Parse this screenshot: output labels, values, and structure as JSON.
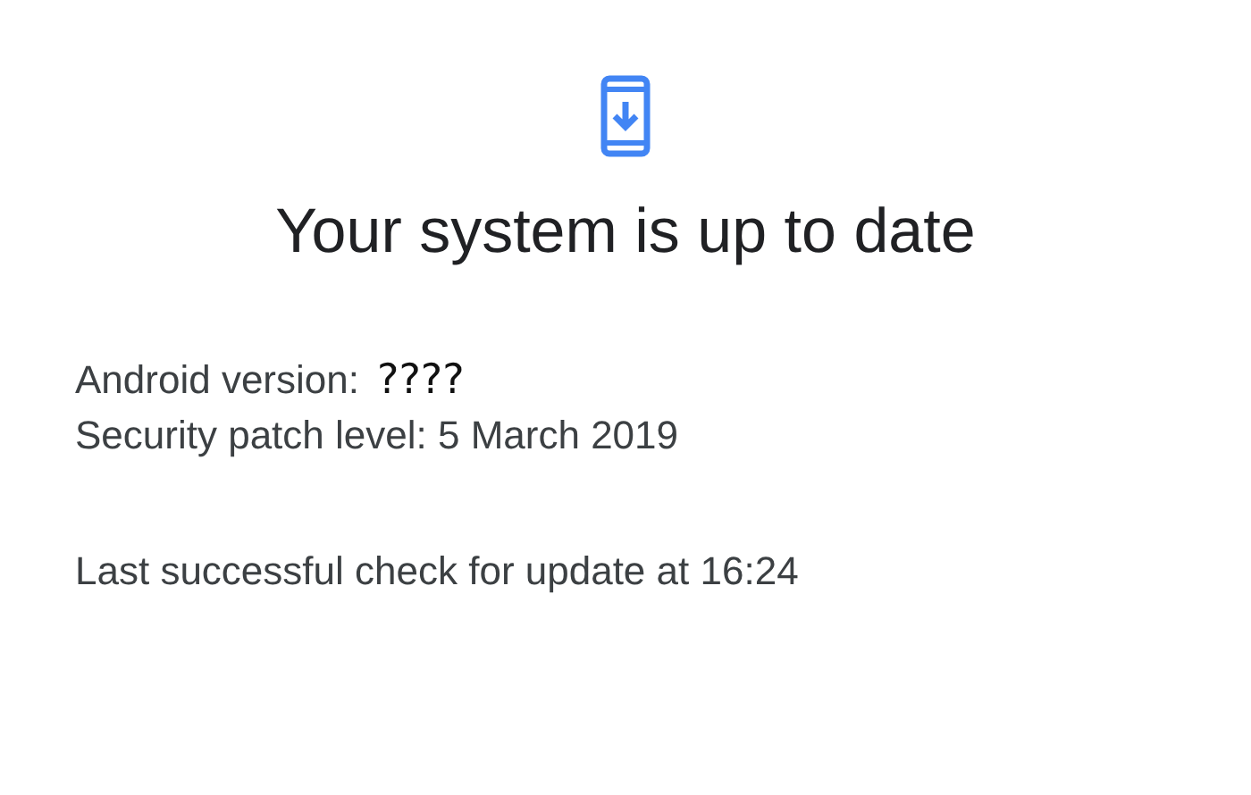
{
  "title": "Your system is up to date",
  "details": [
    {
      "kind": "pair",
      "label": "Android version:",
      "value": "????"
    },
    {
      "kind": "plain",
      "text": "Security patch level: 5 March 2019"
    }
  ],
  "last_check": "Last successful check for update at 16:24"
}
